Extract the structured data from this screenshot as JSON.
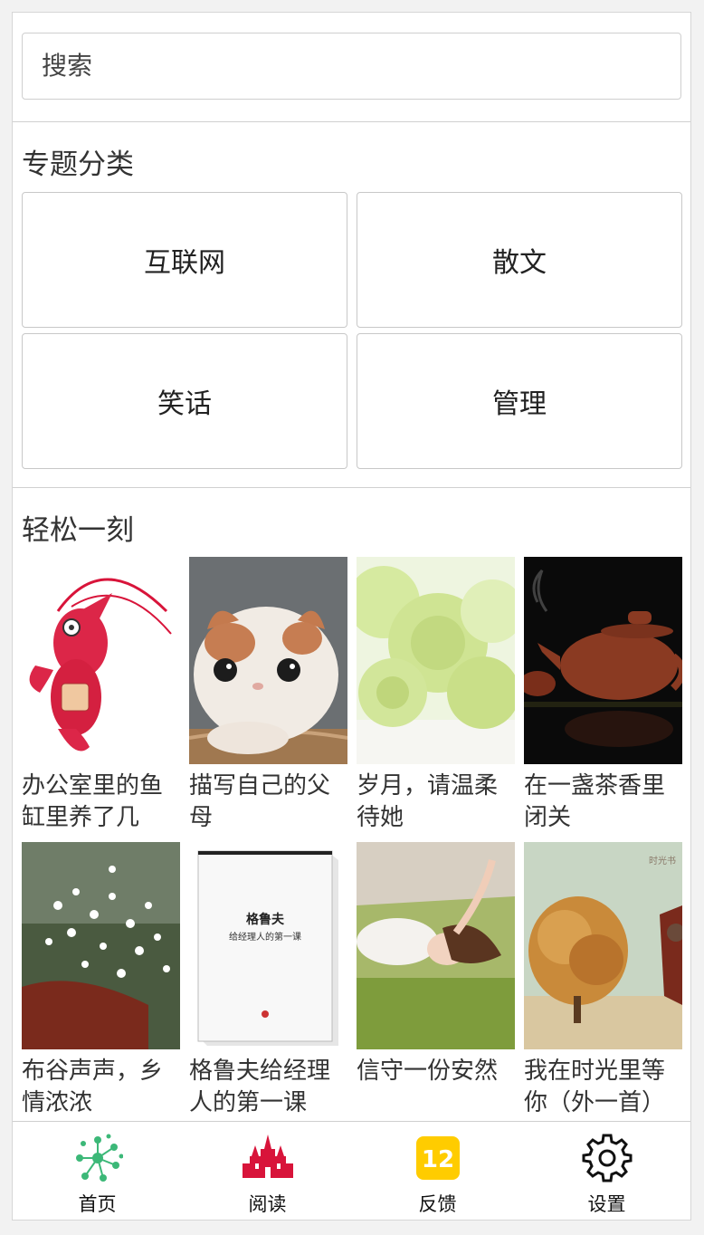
{
  "search": {
    "placeholder": "搜索"
  },
  "categories": {
    "title": "专题分类",
    "items": [
      "互联网",
      "散文",
      "笑话",
      "管理"
    ]
  },
  "relax": {
    "title": "轻松一刻",
    "cards": [
      {
        "title": "办公室里的鱼缸里养了几只…",
        "image": "lobster-cartoon"
      },
      {
        "title": "描写自己的父母",
        "image": "kitten"
      },
      {
        "title": "岁月，请温柔待她",
        "image": "carnation-flowers"
      },
      {
        "title": "在一盏茶香里闭关",
        "image": "teapot"
      },
      {
        "title": "布谷声声，乡情浓浓",
        "image": "white-flowers-bicycle"
      },
      {
        "title": "格鲁夫给经理人的第一课",
        "image": "book-cover"
      },
      {
        "title": "信守一份安然",
        "image": "girl-lying-grass"
      },
      {
        "title": "我在时光里等你（外一首）",
        "image": "autumn-tree"
      }
    ],
    "book_cover_text": {
      "title": "格鲁夫",
      "subtitle": "给经理人的第一课"
    },
    "tree_watermark": "时光书"
  },
  "tabbar": {
    "items": [
      {
        "label": "首页",
        "icon": "molecule-icon"
      },
      {
        "label": "阅读",
        "icon": "castle-icon"
      },
      {
        "label": "反馈",
        "icon": "calendar-12-icon",
        "badge": "12"
      },
      {
        "label": "设置",
        "icon": "gear-icon"
      }
    ]
  },
  "colors": {
    "green": "#3cb878",
    "red": "#d8143a",
    "yellow": "#ffcc00"
  }
}
